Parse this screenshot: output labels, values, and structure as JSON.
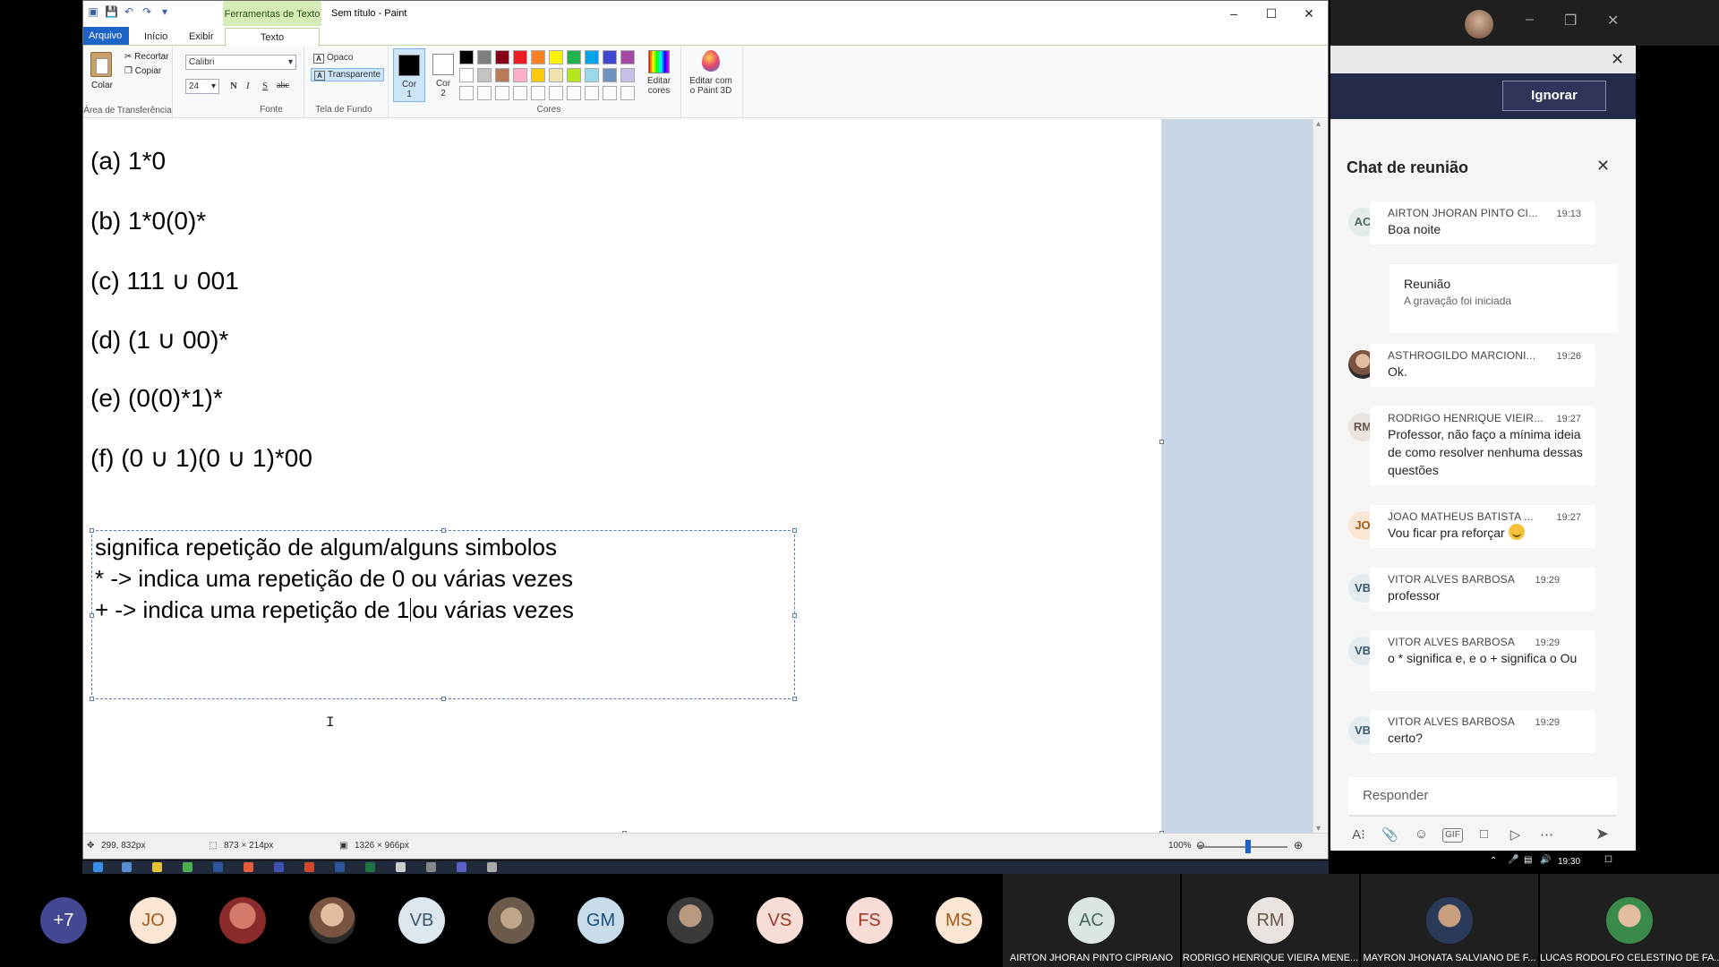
{
  "paint": {
    "context_tab": "Ferramentas de Texto",
    "title": "Sem título - Paint",
    "tabs": [
      "Arquivo",
      "Início",
      "Exibir",
      "Texto"
    ],
    "clipboard": {
      "paste": "Colar",
      "cut": "Recortar",
      "copy": "Copiar",
      "label": "Área de Transferência"
    },
    "font": {
      "family": "Calibri",
      "size": "24",
      "bold": "N",
      "italic": "I",
      "underline": "S",
      "strike": "abc",
      "label": "Fonte"
    },
    "background": {
      "opaque": "Opaco",
      "transparent": "Transparente",
      "label": "Tela de Fundo"
    },
    "colors": {
      "cor1": "Cor\n1",
      "cor2": "Cor\n2",
      "label": "Cores",
      "edit": "Editar\ncores",
      "paint3d": "Editar com\no Paint 3D",
      "palette": [
        "#000000",
        "#7f7f7f",
        "#880015",
        "#ed1c24",
        "#ff7f27",
        "#fff200",
        "#22b14c",
        "#00a2e8",
        "#3f48cc",
        "#a349a4",
        "#ffffff",
        "#c3c3c3",
        "#b97a57",
        "#ffaec9",
        "#ffc90e",
        "#efe4b0",
        "#b5e61d",
        "#99d9ea",
        "#7092be",
        "#c8bfe7",
        "#ffffff",
        "#ffffff",
        "#ffffff",
        "#ffffff",
        "#ffffff",
        "#ffffff",
        "#ffffff",
        "#ffffff",
        "#ffffff",
        "#ffffff"
      ]
    },
    "expressions": [
      "(a) 1*0",
      "(b) 1*0(0)*",
      "(c) 111 ∪ 001",
      "(d) (1 ∪ 00)*",
      "(e) (0(0)*1)*",
      "(f) (0 ∪ 1)(0 ∪ 1)*00"
    ],
    "textbox": {
      "line1": "significa repetição de algum/alguns simbolos",
      "line2": "* -> indica uma repetição de 0 ou várias vezes",
      "line3a": "+ -> indica uma repetição de 1",
      "line3b": "ou várias vezes"
    },
    "status": {
      "cursor": "299, 832px",
      "selection": "873 × 214px",
      "size": "1326 × 966px",
      "zoom": "100%",
      "zoom_level": 1.0
    }
  },
  "taskbar": {
    "clock": "19:30"
  },
  "teams": {
    "ignore": "Ignorar",
    "chat_title": "Chat de reunião",
    "system": {
      "title": "Reunião",
      "subtitle": "A gravação foi iniciada"
    },
    "messages": [
      {
        "initials": "AC",
        "from": "AIRTON JHORAN PINTO CI...",
        "time": "19:13",
        "body": "Boa noite"
      },
      {
        "initials": "",
        "from": "ASTHROGILDO MARCIONI...",
        "time": "19:26",
        "body": "Ok."
      },
      {
        "initials": "RM",
        "from": "RODRIGO HENRIQUE VIEIR...",
        "time": "19:27",
        "body": "Professor, não faço a mínima ideia de como resolver nenhuma dessas questões"
      },
      {
        "initials": "JO",
        "from": "JOAO MATHEUS BATISTA ...",
        "time": "19:27",
        "body": "Vou ficar pra reforçar"
      },
      {
        "initials": "VB",
        "from": "VITOR ALVES BARBOSA",
        "time": "19:29",
        "body": "professor"
      },
      {
        "initials": "VB",
        "from": "VITOR ALVES BARBOSA",
        "time": "19:29",
        "body": "o * significa e, e o + significa o Ou"
      },
      {
        "initials": "VB",
        "from": "VITOR ALVES BARBOSA",
        "time": "19:29",
        "body": "certo?"
      }
    ],
    "reply_placeholder": "Responder",
    "participants": [
      "+7",
      "JO",
      "",
      "",
      "VB",
      "",
      "GM",
      "",
      "VS",
      "FS",
      "MS"
    ],
    "tiles": [
      {
        "initials": "AC",
        "name": "AIRTON JHORAN PINTO CIPRIANO"
      },
      {
        "initials": "RM",
        "name": "RODRIGO HENRIQUE VIEIRA MENE..."
      },
      {
        "initials": "",
        "name": "MAYRON JHONATA SALVIANO DE F..."
      },
      {
        "initials": "",
        "name": "LUCAS RODOLFO CELESTINO DE FA..."
      }
    ]
  }
}
